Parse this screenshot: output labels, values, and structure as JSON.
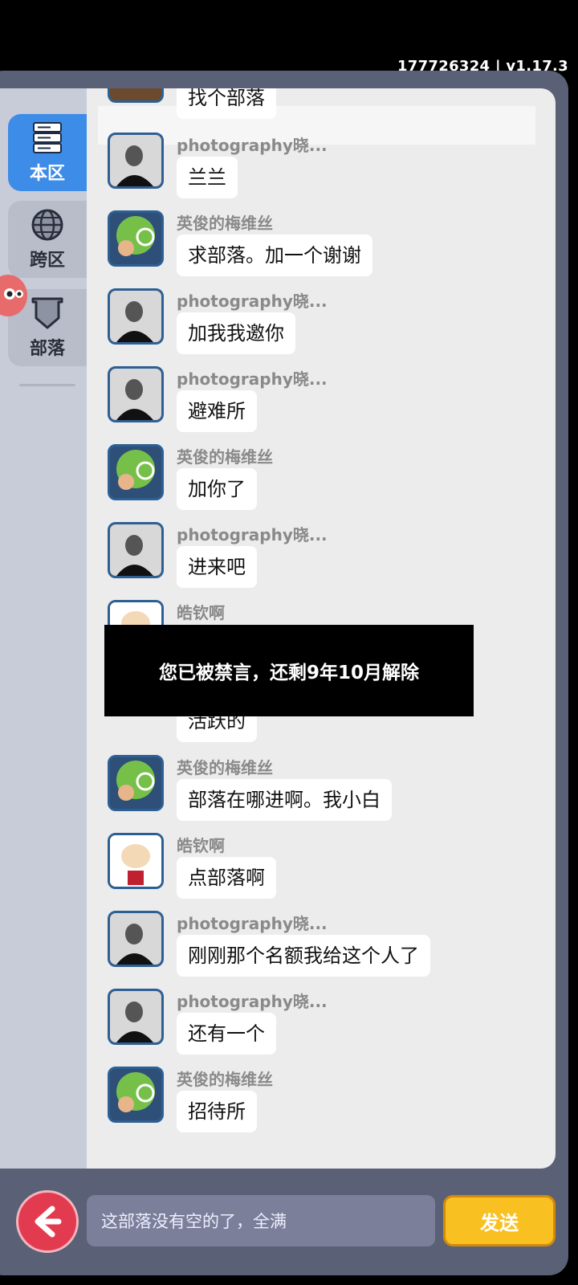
{
  "header": {
    "version_text": "177726324 | v1.17.3"
  },
  "sidebar": {
    "tabs": [
      {
        "label": "本区",
        "icon": "server-icon"
      },
      {
        "label": "跨区",
        "icon": "globe-icon"
      },
      {
        "label": "部落",
        "icon": "shield-icon"
      }
    ]
  },
  "chat": {
    "messages": [
      {
        "name": "",
        "text": "找个部落",
        "avatar": "brown"
      },
      {
        "name": "photography晓...",
        "text": "兰兰",
        "avatar": "photo"
      },
      {
        "name": "英俊的梅维丝",
        "text": "求部落。加一个谢谢",
        "avatar": "green"
      },
      {
        "name": "photography晓...",
        "text": "加我我邀你",
        "avatar": "photo"
      },
      {
        "name": "photography晓...",
        "text": "避难所",
        "avatar": "photo"
      },
      {
        "name": "英俊的梅维丝",
        "text": "加你了",
        "avatar": "green"
      },
      {
        "name": "photography晓...",
        "text": "进来吧",
        "avatar": "photo"
      },
      {
        "name": "皓钦啊",
        "text": "活跃的",
        "avatar": "guy"
      },
      {
        "name": "英俊的梅维丝",
        "text": "部落在哪进啊。我小白",
        "avatar": "green"
      },
      {
        "name": "皓钦啊",
        "text": "点部落啊",
        "avatar": "guy"
      },
      {
        "name": "photography晓...",
        "text": "刚刚那个名额我给这个人了",
        "avatar": "photo"
      },
      {
        "name": "photography晓...",
        "text": "还有一个",
        "avatar": "photo"
      },
      {
        "name": "英俊的梅维丝",
        "text": "招待所",
        "avatar": "green"
      }
    ]
  },
  "toast": {
    "text": "您已被禁言，还剩9年10月解除"
  },
  "footer": {
    "input_value": "这部落没有空的了，全满",
    "send_label": "发送"
  }
}
